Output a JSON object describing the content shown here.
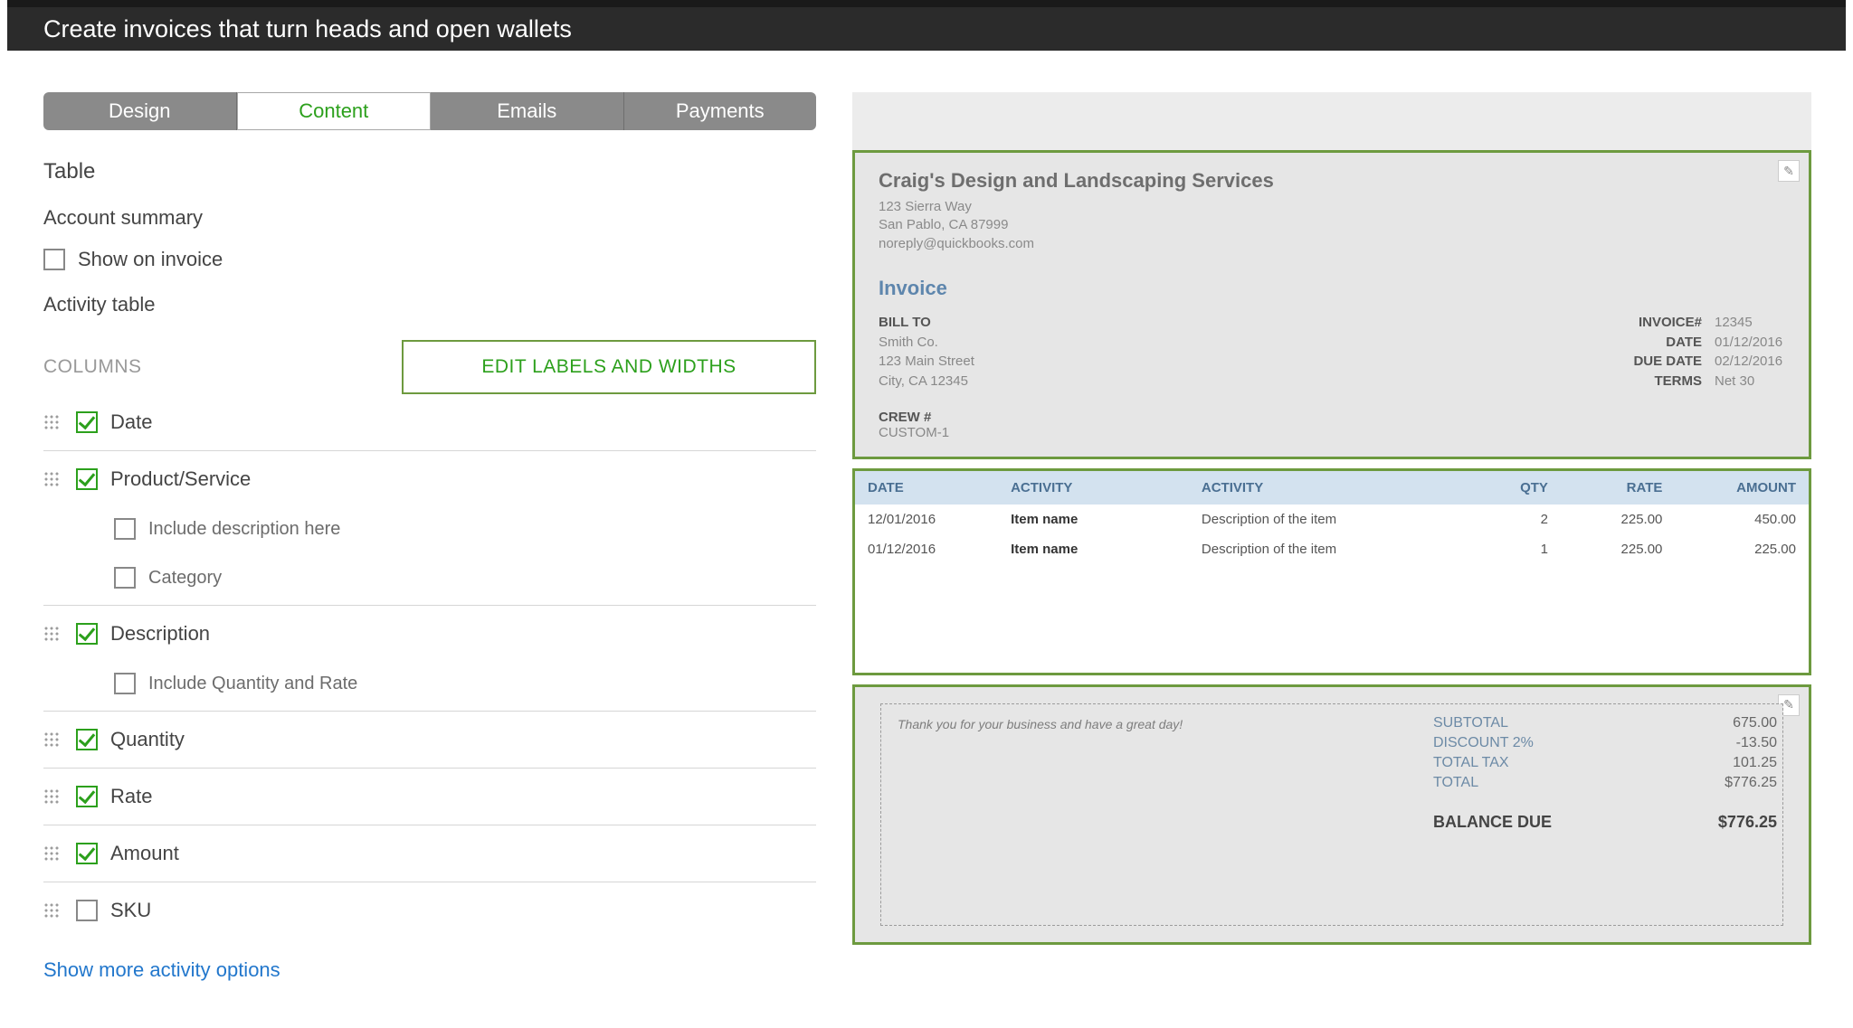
{
  "page_title": "Create invoices that turn heads and open wallets",
  "tabs": [
    "Design",
    "Content",
    "Emails",
    "Payments"
  ],
  "active_tab": 1,
  "section_table_label": "Table",
  "account_summary_label": "Account summary",
  "show_on_invoice_label": "Show on invoice",
  "activity_table_label": "Activity table",
  "columns_label": "COLUMNS",
  "edit_labels_btn": "EDIT LABELS AND WIDTHS",
  "columns": [
    {
      "label": "Date",
      "checked": true,
      "sub": []
    },
    {
      "label": "Product/Service",
      "checked": true,
      "sub": [
        {
          "label": "Include description here",
          "checked": false
        },
        {
          "label": "Category",
          "checked": false
        }
      ]
    },
    {
      "label": "Description",
      "checked": true,
      "sub": [
        {
          "label": "Include Quantity and Rate",
          "checked": false
        }
      ]
    },
    {
      "label": "Quantity",
      "checked": true,
      "sub": []
    },
    {
      "label": "Rate",
      "checked": true,
      "sub": []
    },
    {
      "label": "Amount",
      "checked": true,
      "sub": []
    },
    {
      "label": "SKU",
      "checked": false,
      "sub": []
    }
  ],
  "more_activity_link": "Show more activity options",
  "preview": {
    "company_name": "Craig's Design and Landscaping Services",
    "address_line1": "123 Sierra Way",
    "address_line2": "San Pablo, CA 87999",
    "email": "noreply@quickbooks.com",
    "invoice_label": "Invoice",
    "bill_to_label": "BILL TO",
    "bill_to_name": "Smith Co.",
    "bill_to_addr1": "123 Main Street",
    "bill_to_addr2": "City, CA 12345",
    "meta": {
      "invoice_no_label": "INVOICE#",
      "invoice_no": "12345",
      "date_label": "DATE",
      "date": "01/12/2016",
      "due_label": "DUE DATE",
      "due": "02/12/2016",
      "terms_label": "TERMS",
      "terms": "Net 30"
    },
    "crew_label": "CREW #",
    "crew_value": "CUSTOM-1",
    "table_headers": {
      "date": "DATE",
      "activity1": "ACTIVITY",
      "activity2": "ACTIVITY",
      "qty": "QTY",
      "rate": "RATE",
      "amount": "AMOUNT"
    },
    "table_rows": [
      {
        "date": "12/01/2016",
        "item": "Item name",
        "desc": "Description of the item",
        "qty": "2",
        "rate": "225.00",
        "amount": "450.00"
      },
      {
        "date": "01/12/2016",
        "item": "Item name",
        "desc": "Description of the item",
        "qty": "1",
        "rate": "225.00",
        "amount": "225.00"
      }
    ],
    "thank_you": "Thank you for your business and have a great day!",
    "totals": {
      "subtotal_label": "SUBTOTAL",
      "subtotal": "675.00",
      "discount_label": "DISCOUNT 2%",
      "discount": "-13.50",
      "tax_label": "TOTAL TAX",
      "tax": "101.25",
      "total_label": "TOTAL",
      "total": "$776.25",
      "balance_label": "BALANCE DUE",
      "balance": "$776.25"
    }
  }
}
